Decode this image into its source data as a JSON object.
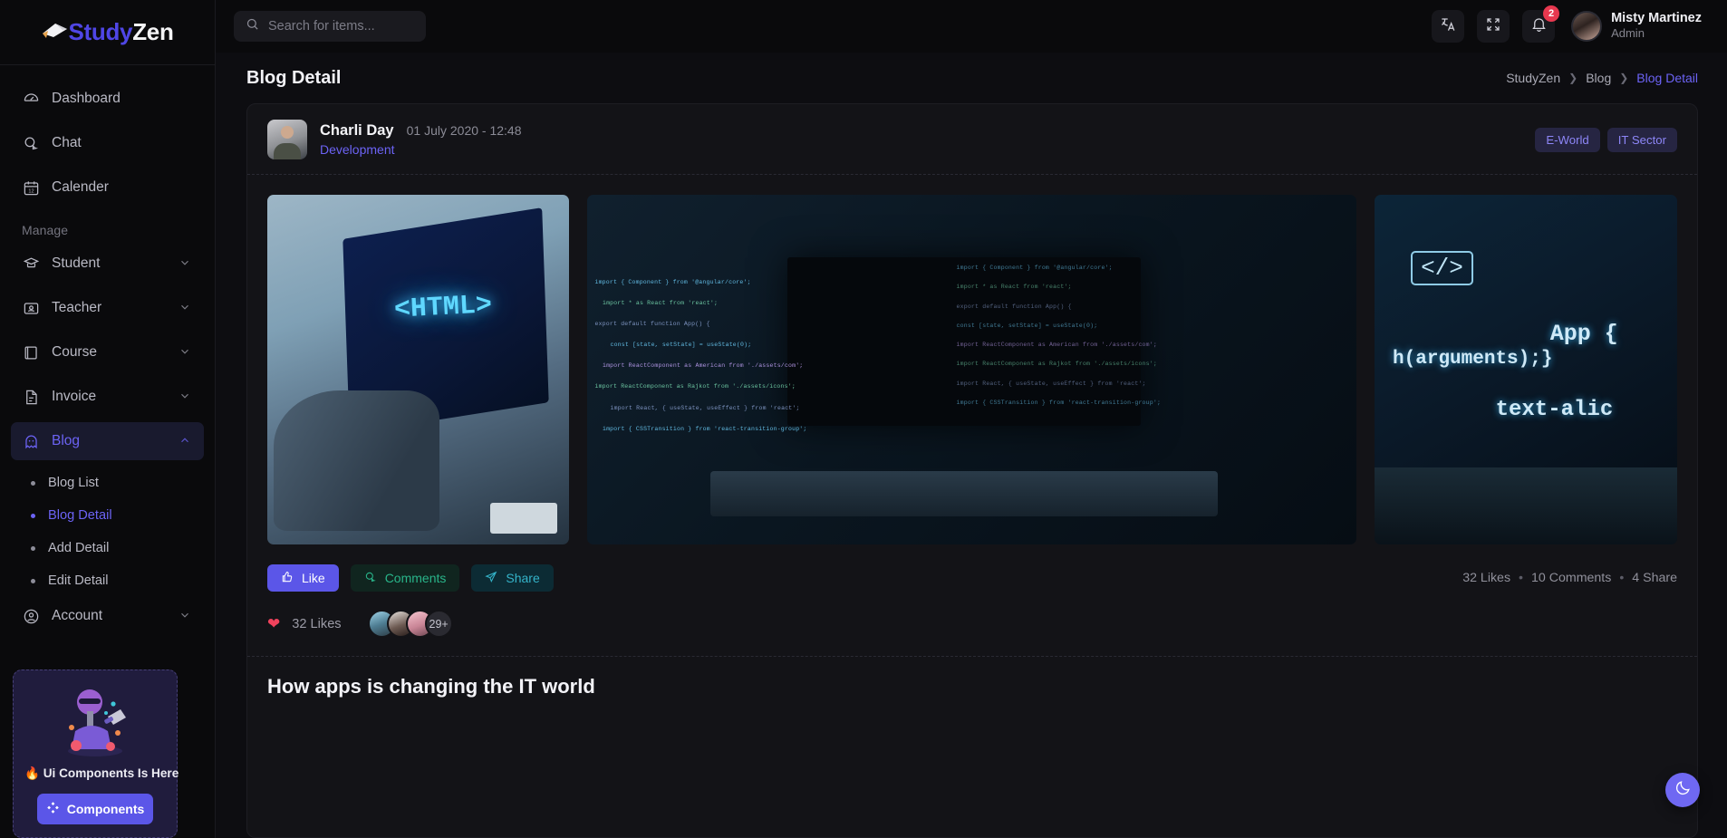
{
  "brand": {
    "part1": "Study",
    "part2": "Zen",
    "icon": "graduation-cap-icon"
  },
  "sidebar": {
    "primary": [
      {
        "label": "Dashboard",
        "icon": "dashboard-icon"
      },
      {
        "label": "Chat",
        "icon": "chat-icon"
      },
      {
        "label": "Calender",
        "icon": "calendar-icon"
      }
    ],
    "section_label": "Manage",
    "manage": [
      {
        "label": "Student",
        "icon": "student-cap-icon",
        "expandable": true,
        "expanded": false
      },
      {
        "label": "Teacher",
        "icon": "teacher-icon",
        "expandable": true,
        "expanded": false
      },
      {
        "label": "Course",
        "icon": "book-icon",
        "expandable": true,
        "expanded": false
      },
      {
        "label": "Invoice",
        "icon": "file-invoice-icon",
        "expandable": true,
        "expanded": false
      },
      {
        "label": "Blog",
        "icon": "ghost-icon",
        "expandable": true,
        "expanded": true,
        "active": true
      }
    ],
    "blog_children": [
      {
        "label": "Blog List",
        "current": false
      },
      {
        "label": "Blog Detail",
        "current": true
      },
      {
        "label": "Add Detail",
        "current": false
      },
      {
        "label": "Edit Detail",
        "current": false
      }
    ],
    "account": {
      "label": "Account",
      "icon": "user-circle-icon",
      "expandable": true
    },
    "promo": {
      "title": "🔥 Ui Components Is Here",
      "button_label": "Components",
      "button_icon": "components-icon"
    }
  },
  "topbar": {
    "search": {
      "placeholder": "Search for items...",
      "value": "",
      "icon": "search-icon"
    },
    "language_icon": "translate-icon",
    "fullscreen_icon": "fullscreen-icon",
    "notification_icon": "bell-icon",
    "notification_count": "2",
    "user": {
      "name": "Misty Martinez",
      "role": "Admin",
      "avatar": "user-avatar"
    }
  },
  "page": {
    "title": "Blog Detail",
    "breadcrumb": [
      {
        "label": "StudyZen",
        "current": false
      },
      {
        "label": "Blog",
        "current": false
      },
      {
        "label": "Blog Detail",
        "current": true
      }
    ]
  },
  "post": {
    "author": {
      "name": "Charli Day",
      "category": "Development",
      "avatar": "author-avatar"
    },
    "date": "01 July 2020 - 12:48",
    "tags": [
      "E-World",
      "IT Sector"
    ],
    "gallery": [
      {
        "alt": "laptop showing HTML code",
        "name": "blog-image-1"
      },
      {
        "alt": "developer coding with overlay",
        "name": "blog-image-2"
      },
      {
        "alt": "developer at terminal screens",
        "name": "blog-image-3"
      }
    ],
    "actions": [
      {
        "label": "Like",
        "icon": "thumbs-up-icon",
        "style": "like"
      },
      {
        "label": "Comments",
        "icon": "comment-icon",
        "style": "comments"
      },
      {
        "label": "Share",
        "icon": "send-icon",
        "style": "share"
      }
    ],
    "stats": {
      "likes": "32 Likes",
      "comments": "10 Comments",
      "shares": "4 Share",
      "bullet": "•"
    },
    "likes_bar": {
      "heart_icon": "heart-icon",
      "text": "32 Likes",
      "overflow": "29+"
    },
    "title": "How apps is changing the IT world"
  },
  "theme_toggle": {
    "icon": "moon-icon"
  },
  "colors": {
    "accent": "#6c63f5",
    "accent_button": "#5b56e8",
    "comments": "#29b58a",
    "share": "#34b3c9",
    "badge": "#e8384f",
    "heart": "#f0425c",
    "bg": "#0a0a0c",
    "card": "#131317"
  },
  "img2_code": [
    "import { Component } from '@angular/core';",
    "import * as React from 'react';",
    "export default function App() {",
    "const [state, setState] = useState(0);",
    "import ReactComponent as American from './assets/com';",
    "import ReactComponent as Rajkot from './assets/icons';",
    "import React, { useState, useEffect } from 'react';",
    "import { CSSTransition } from 'react-transition-group';"
  ],
  "img3_code": [
    "h(arguments);}",
    "text-alig",
    "App {",
    "</>"
  ]
}
